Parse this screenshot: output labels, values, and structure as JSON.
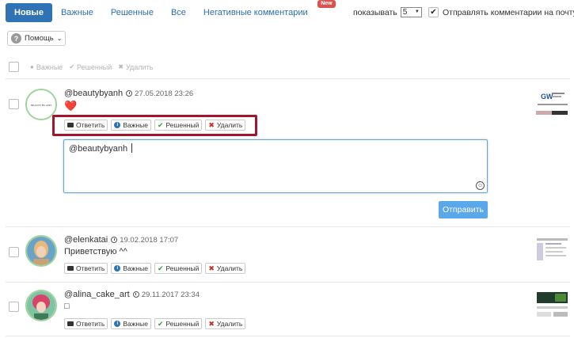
{
  "tabs": [
    {
      "label": "Новые",
      "active": true
    },
    {
      "label": "Важные",
      "active": false
    },
    {
      "label": "Решенные",
      "active": false
    },
    {
      "label": "Все",
      "active": false
    },
    {
      "label": "Негативные комментарии",
      "active": false,
      "badge": "New"
    }
  ],
  "controls": {
    "show_label": "показывать",
    "show_value": "5",
    "email_label": "Отправлять комментарии на почту?",
    "email_checked": true,
    "help_label": "Помощь"
  },
  "bulk_actions": {
    "important": "Важные",
    "resolved": "Решенный",
    "delete": "Удалить"
  },
  "action_labels": {
    "reply": "Ответить",
    "important": "Важные",
    "resolved": "Решенный",
    "delete": "Удалить"
  },
  "comments": [
    {
      "username": "@beautybyanh",
      "date": "27.05.2018 23:26",
      "text": "❤️",
      "avatar_text": "BEAUTY BY ANH"
    },
    {
      "username": "@elenkatai",
      "date": "19.02.2018 17:07",
      "text": "Приветствую ^^"
    },
    {
      "username": "@alina_cake_art",
      "date": "29.11.2017 23:34",
      "text": "□"
    }
  ],
  "reply": {
    "value": "@beautybyanh ",
    "send_label": "Отправить"
  },
  "thumb1": {
    "logo": "GW"
  },
  "colors": {
    "accent": "#2f72b5",
    "send": "#5aa7ea",
    "highlight": "#a3142d",
    "badge": "#d9534f"
  }
}
